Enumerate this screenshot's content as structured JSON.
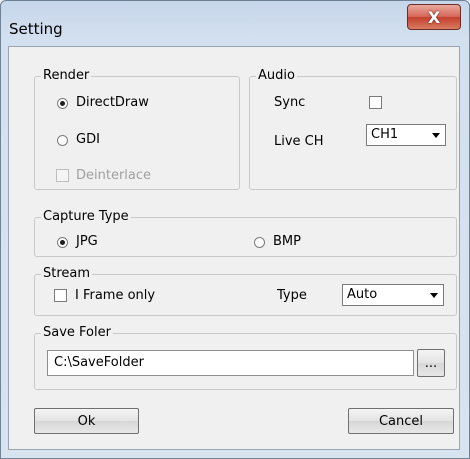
{
  "window": {
    "title": "Setting",
    "close_label": "X"
  },
  "render": {
    "title": "Render",
    "options": [
      {
        "label": "DirectDraw",
        "checked": true
      },
      {
        "label": "GDI",
        "checked": false
      }
    ],
    "deinterlace_label": "Deinterlace",
    "deinterlace_checked": false
  },
  "audio": {
    "title": "Audio",
    "sync_label": "Sync",
    "sync_checked": false,
    "live_ch_label": "Live CH",
    "live_ch_value": "CH1"
  },
  "capture": {
    "title": "Capture Type",
    "options": [
      {
        "label": "JPG",
        "checked": true
      },
      {
        "label": "BMP",
        "checked": false
      }
    ]
  },
  "stream": {
    "title": "Stream",
    "iframe_label": "I Frame only",
    "iframe_checked": false,
    "type_label": "Type",
    "type_value": "Auto"
  },
  "save": {
    "title": "Save Foler",
    "path": "C:\\SaveFolder",
    "browse_label": "..."
  },
  "buttons": {
    "ok": "Ok",
    "cancel": "Cancel"
  }
}
